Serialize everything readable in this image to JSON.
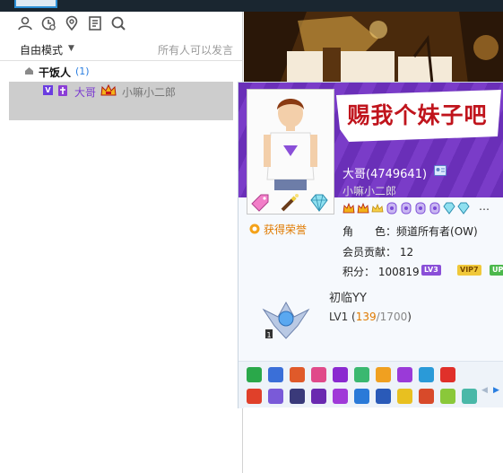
{
  "mode_bar": {
    "mode_label": "自由模式",
    "permission_text": "所有人可以发言"
  },
  "channel": {
    "name": "干饭人",
    "count": "(1)"
  },
  "user_row": {
    "badge": "V",
    "name": "大哥",
    "signature": "小嘛小二郎"
  },
  "profile_card": {
    "slogan": "赐我个妹子吧",
    "name": "大哥(4749641)",
    "signature": "小嘛小二郎",
    "honor_label": "获得荣誉",
    "role_label": "角　　色：",
    "role_value": "频道所有者(OW)",
    "contribution_label": "会员贡献：",
    "contribution_value": "12",
    "points_label": "积分：",
    "points_value": "100819",
    "badge_lv3": "LV3",
    "badge_vip": "VIP7",
    "badge_up": "UP",
    "more": "…",
    "yy_title": "初临YY",
    "yy_level": "LV1",
    "yy_progress_current": "139",
    "yy_progress_sep": "/",
    "yy_progress_max": "1700",
    "yy_progress_fraction": 0.082,
    "yy_badge_number": "1"
  },
  "colors": {
    "accent_purple": "#7a3ad0",
    "accent_orange": "#e07a00",
    "link_blue": "#2a7ee0",
    "slogan_red": "#c0141c"
  }
}
